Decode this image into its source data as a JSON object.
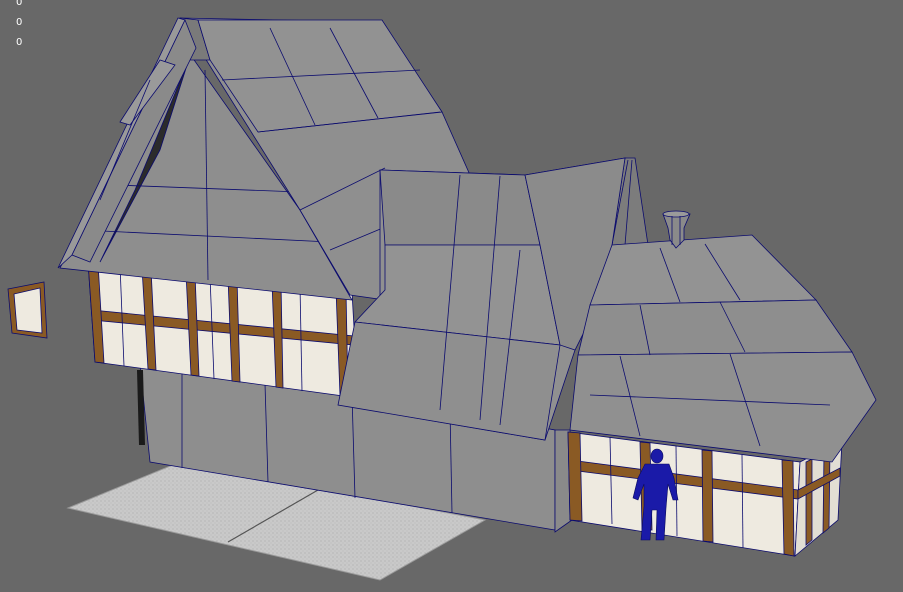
{
  "viewport": {
    "background": "#686868",
    "hud_values": [
      "0",
      "0",
      "0"
    ],
    "wire_color": "#0b0b6e",
    "shade_color": "#8c8c8c",
    "plaster_color": "#eeeae0",
    "timber_color": "#8a5a24",
    "figure_color": "#1a1aa8",
    "figure_icon": "human-scale-reference",
    "chimney_icon": "chimney-pot-mesh"
  }
}
